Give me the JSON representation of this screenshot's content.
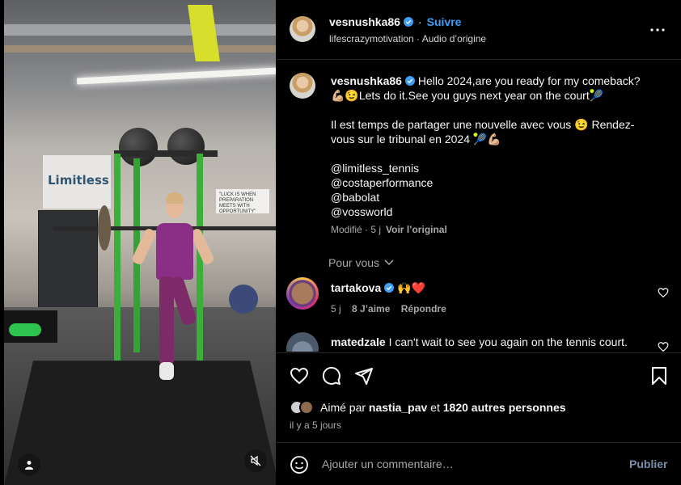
{
  "post": {
    "username": "vesnushka86",
    "follow_label": "Suivre",
    "separator": "·",
    "subtitle": "lifescrazymotivation · Audio d’origine"
  },
  "video": {
    "banner_text": "Limitless",
    "sign_text": "\"LUCK IS WHEN PREPARATION MEETS WITH OPPORTUNITY\""
  },
  "caption": {
    "username": "vesnushka86",
    "text": " Hello 2024,are you ready for my comeback? 💪🏼😉Lets do it.See you guys next year on the court🎾\n\nIl est temps de partager une nouvelle avec vous 😉 Rendez-vous sur le tribunal en 2024 🎾💪🏼\n\n@limitless_tennis\n@costaperformance\n@babolat\n@vossworld",
    "meta": "Modifié · 5 j",
    "see_original": "Voir l’original",
    "translate_label": "Pour vous"
  },
  "comments": [
    {
      "username": "tartakova",
      "text": " 🙌❤️",
      "age": "5 j",
      "likes": "8 J’aime",
      "reply": "Répondre"
    },
    {
      "username": "matedzale",
      "text": " I can't wait to see you again on the tennis court."
    }
  ],
  "likes": {
    "prefix": "Aimé par ",
    "user": "nastia_pav",
    "middle": " et ",
    "others": "1820 autres personnes"
  },
  "timestamp": "il y a 5 jours",
  "add_comment": {
    "placeholder": "Ajouter un commentaire…",
    "publish_label": "Publier"
  },
  "icons": [
    "verified-icon",
    "more-icon",
    "heart-icon",
    "comment-icon",
    "share-icon",
    "bookmark-icon",
    "emoji-icon",
    "mute-icon",
    "user-icon",
    "chevron-down-icon"
  ],
  "colors": {
    "accent": "#3f9ef9",
    "background": "#000000",
    "muted": "#a8a8a8",
    "publish": "#7a8fa8"
  }
}
